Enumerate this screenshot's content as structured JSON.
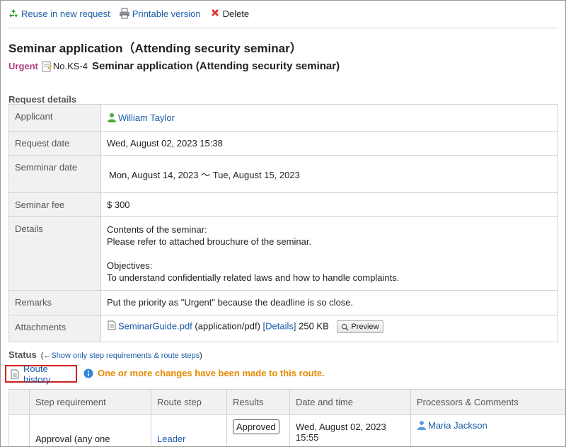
{
  "toolbar": {
    "reuse_label": "Reuse in new request",
    "print_label": "Printable version",
    "delete_label": "Delete"
  },
  "page_title": "Seminar application（Attending security seminar）",
  "request": {
    "priority": "Urgent",
    "number": "No.KS-4",
    "title": "Seminar application (Attending security seminar)"
  },
  "details_section": {
    "heading": "Request details",
    "rows": [
      {
        "label": "Applicant",
        "value": "William Taylor"
      },
      {
        "label": "Request date",
        "value": "Wed, August 02, 2023 15:38"
      },
      {
        "label": "Semminar date",
        "value": "Mon, August 14, 2023 〜 Tue, August 15, 2023"
      },
      {
        "label": "Seminar fee",
        "value": "$ 300"
      },
      {
        "label": "Details",
        "lines": [
          "Contents of the seminar:",
          "Please refer to attached brouchure of the seminar.",
          "Objectives:",
          "To understand confidentially related laws and how to handle complaints."
        ]
      },
      {
        "label": "Remarks",
        "value": "Put the priority as \"Urgent\" because the deadline is so close."
      },
      {
        "label": "Attachments",
        "file_name": "SeminarGuide.pdf",
        "file_type": "(application/pdf)",
        "details_link": "[Details]",
        "file_size": "250 KB",
        "preview_label": "Preview"
      }
    ]
  },
  "status": {
    "title": "Status",
    "arrow": "(←",
    "toggle_link": "Show only step requirements & route steps",
    "close_paren": ")",
    "route_history_label": "Route history",
    "notice": "One or more changes have been made to this route."
  },
  "route_table": {
    "headers": [
      "Step requirement",
      "Route step",
      "Results",
      "Date and time",
      "Processors & Comments"
    ],
    "rows": [
      {
        "requirement": "Approval (any one approver)",
        "step": "Leader",
        "result": "Approved",
        "datetime": "Wed, August 02, 2023 15:55",
        "processor": "Maria Jackson"
      }
    ]
  },
  "colors": {
    "link": "#1a5ca8",
    "urgent": "#b0407f",
    "notice": "#e58a00",
    "highlight_border": "#d0201b"
  }
}
